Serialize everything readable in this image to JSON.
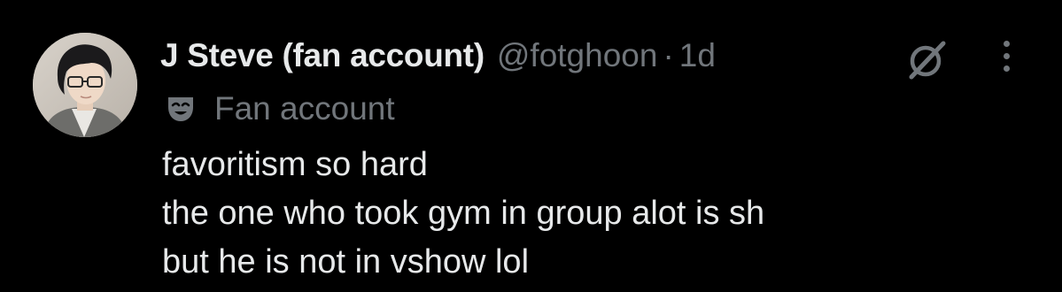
{
  "colors": {
    "background": "#000000",
    "primary_text": "#e7e9ea",
    "secondary_text": "#71767b"
  },
  "tweet": {
    "avatar_icon": "profile-photo",
    "display_name": "J Steve (fan account)",
    "handle": "@fotghoon",
    "separator": "·",
    "time": "1d",
    "grok_icon": "grok-icon",
    "more_icon": "more-options-icon",
    "label_icon": "theater-mask-icon",
    "label": "Fan account",
    "lines": [
      "favoritism so hard",
      "the one who took gym in group alot is sh",
      "but he is not in vshow lol"
    ]
  }
}
